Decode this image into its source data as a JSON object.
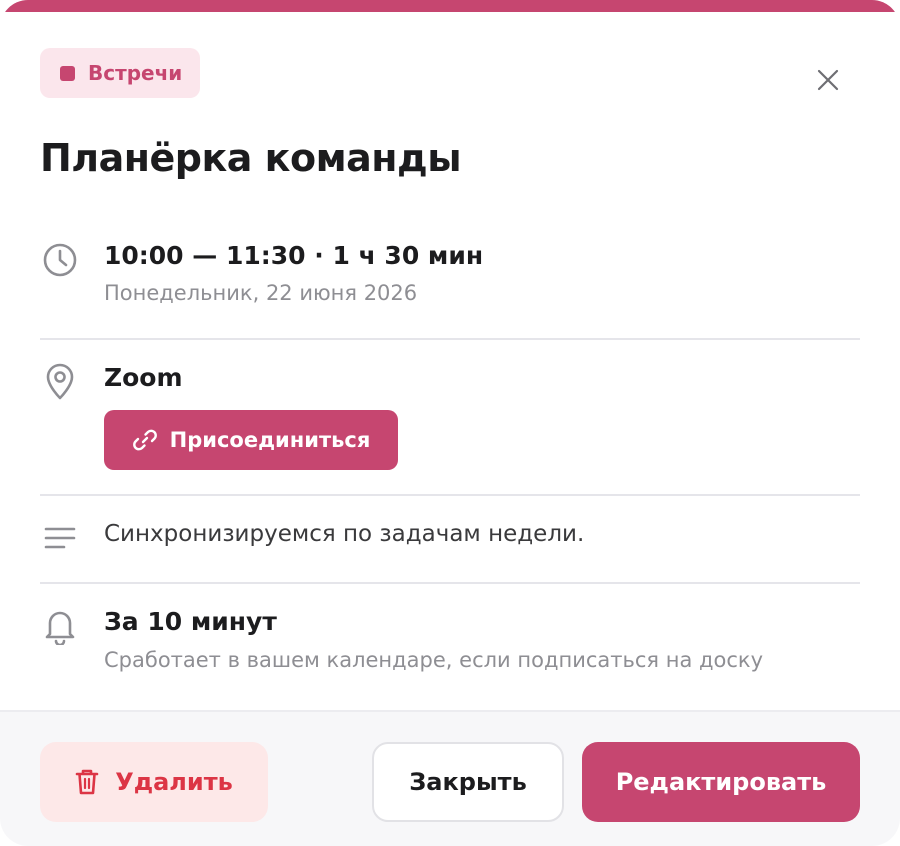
{
  "colors": {
    "accent": "#c64670",
    "accent_soft": "#fbe6ec",
    "danger": "#dc3545",
    "danger_soft": "#fde8e8"
  },
  "category": {
    "label": "Встречи",
    "icon": "square-dot-icon"
  },
  "title": "Планёрка команды",
  "time": {
    "primary": "10:00 — 11:30 · 1 ч 30 мин",
    "secondary": "Понедельник, 22 июня 2026",
    "icon": "clock-icon"
  },
  "location": {
    "name": "Zoom",
    "icon": "location-pin-icon",
    "join_label": "Присоединиться",
    "join_icon": "link-icon"
  },
  "description": {
    "text": "Синхронизируемся по задачам недели.",
    "icon": "text-lines-icon"
  },
  "reminder": {
    "primary": "За 10 минут",
    "secondary": "Сработает в вашем календаре, если подписаться на доску",
    "icon": "bell-icon"
  },
  "footer": {
    "delete_label": "Удалить",
    "delete_icon": "trash-icon",
    "close_label": "Закрыть",
    "edit_label": "Редактировать"
  },
  "close_icon": "close-icon"
}
